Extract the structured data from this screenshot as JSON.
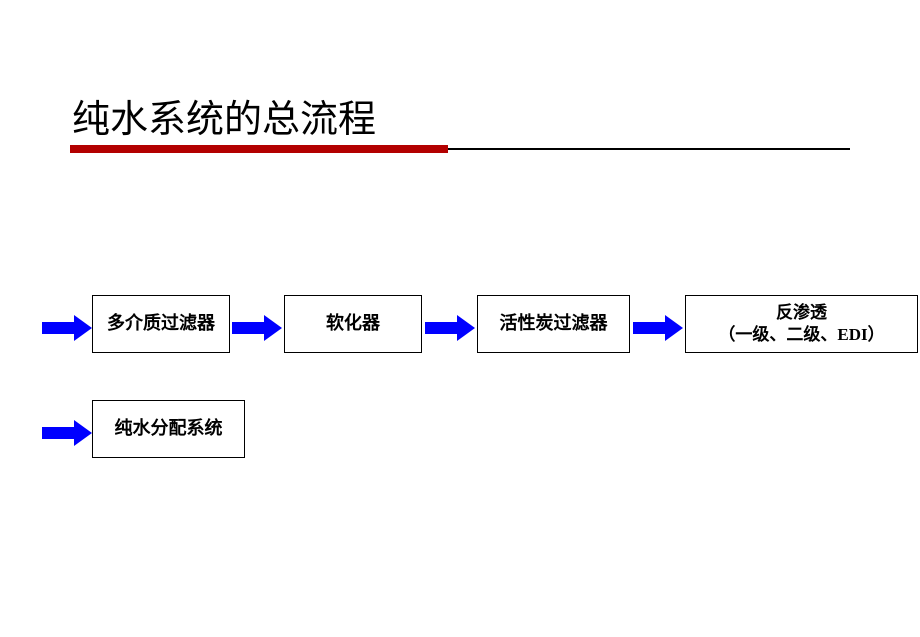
{
  "title": "纯水系统的总流程",
  "flow": {
    "boxes": [
      {
        "label": "多介质过滤器"
      },
      {
        "label": "软化器"
      },
      {
        "label": "活性炭过滤器"
      },
      {
        "label_line1": "反渗透",
        "label_line2": "（一级、二级、EDI）"
      },
      {
        "label": "纯水分配系统"
      }
    ]
  }
}
